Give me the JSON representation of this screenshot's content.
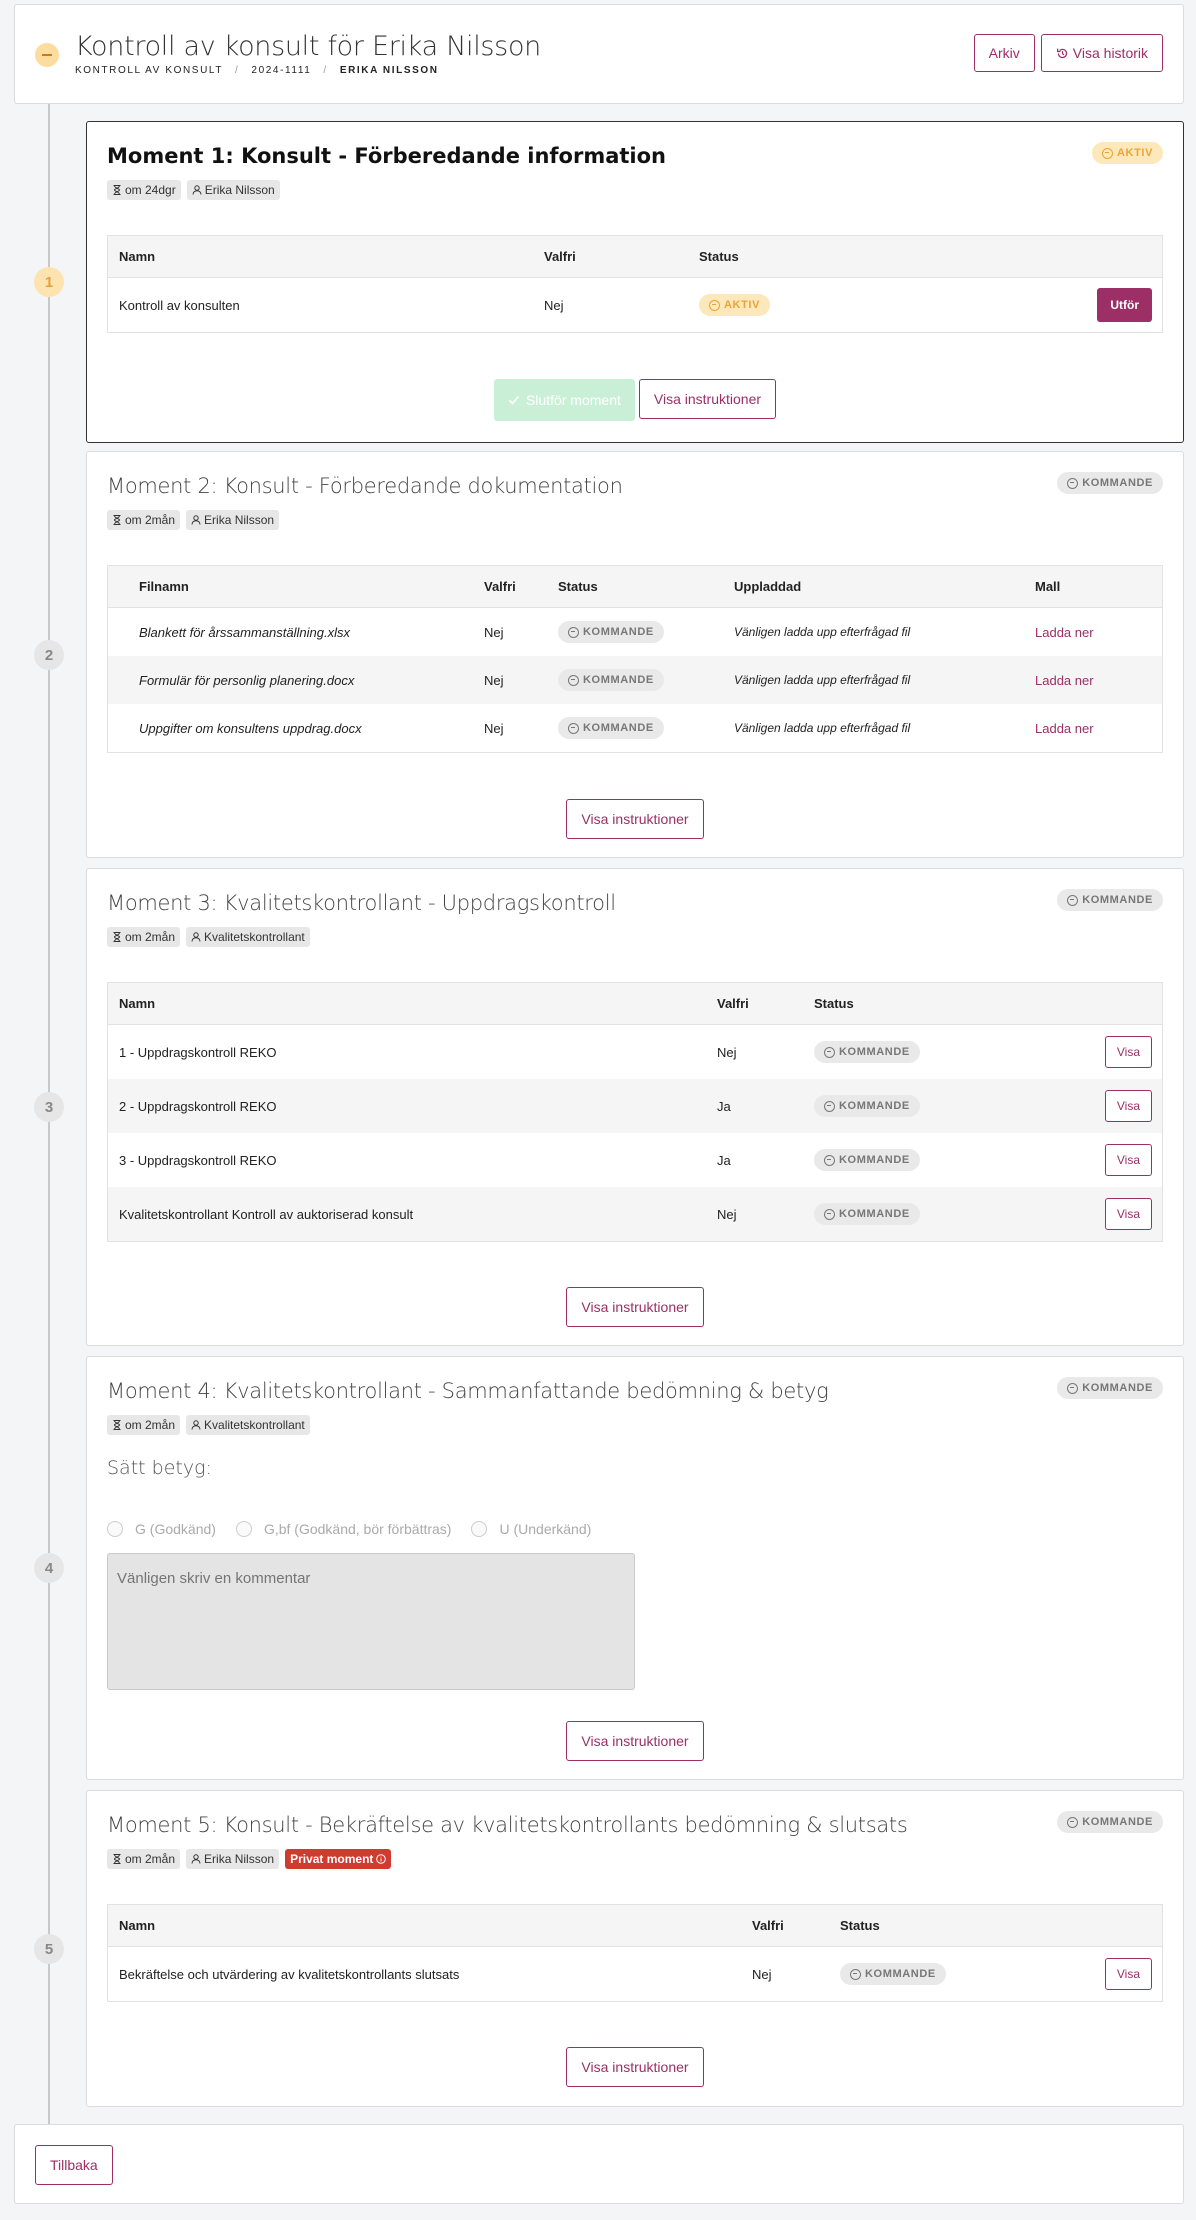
{
  "header": {
    "title": "Kontroll av konsult för Erika Nilsson",
    "crumb1": "KONTROLL AV KONSULT",
    "crumb2": "2024-1111",
    "crumb3": "ERIKA NILSSON",
    "sep": "/",
    "archive_label": "Arkiv",
    "history_label": "Visa historik"
  },
  "steps": [
    "1",
    "2",
    "3",
    "4",
    "5"
  ],
  "common": {
    "instructions_label": "Visa instruktioner",
    "status_kommande": "KOMMANDE",
    "status_aktiv": "AKTIV"
  },
  "moment1": {
    "title": "Moment 1: Konsult - Förberedande information",
    "due": "om 24dgr",
    "assignee": "Erika Nilsson",
    "status": "AKTIV",
    "columns": [
      "Namn",
      "Valfri",
      "Status"
    ],
    "rows": [
      {
        "name": "Kontroll av konsulten",
        "optional": "Nej",
        "status": "AKTIV",
        "action": "Utför"
      }
    ],
    "complete_label": "Slutför moment"
  },
  "moment2": {
    "title": "Moment 2: Konsult - Förberedande dokumentation",
    "due": "om 2mån",
    "assignee": "Erika Nilsson",
    "status": "KOMMANDE",
    "columns": [
      "Filnamn",
      "Valfri",
      "Status",
      "Uppladdad",
      "Mall"
    ],
    "rows": [
      {
        "file": "Blankett för årssammanställning.xlsx",
        "optional": "Nej",
        "status": "KOMMANDE",
        "uploaded": "Vänligen ladda upp efterfrågad fil",
        "template": "Ladda ner"
      },
      {
        "file": "Formulär för personlig planering.docx",
        "optional": "Nej",
        "status": "KOMMANDE",
        "uploaded": "Vänligen ladda upp efterfrågad fil",
        "template": "Ladda ner"
      },
      {
        "file": "Uppgifter om konsultens uppdrag.docx",
        "optional": "Nej",
        "status": "KOMMANDE",
        "uploaded": "Vänligen ladda upp efterfrågad fil",
        "template": "Ladda ner"
      }
    ]
  },
  "moment3": {
    "title": "Moment 3: Kvalitetskontrollant - Uppdragskontroll",
    "due": "om 2mån",
    "assignee": "Kvalitetskontrollant",
    "status": "KOMMANDE",
    "columns": [
      "Namn",
      "Valfri",
      "Status"
    ],
    "rows": [
      {
        "name": "1 - Uppdragskontroll REKO",
        "optional": "Nej",
        "status": "KOMMANDE",
        "action": "Visa"
      },
      {
        "name": "2 - Uppdragskontroll REKO",
        "optional": "Ja",
        "status": "KOMMANDE",
        "action": "Visa"
      },
      {
        "name": "3 - Uppdragskontroll REKO",
        "optional": "Ja",
        "status": "KOMMANDE",
        "action": "Visa"
      },
      {
        "name": "Kvalitetskontrollant Kontroll av auktoriserad konsult",
        "optional": "Nej",
        "status": "KOMMANDE",
        "action": "Visa"
      }
    ]
  },
  "moment4": {
    "title": "Moment 4: Kvalitetskontrollant - Sammanfattande bedömning & betyg",
    "due": "om 2mån",
    "assignee": "Kvalitetskontrollant",
    "status": "KOMMANDE",
    "grade_label": "Sätt betyg:",
    "options": [
      "G (Godkänd)",
      "G,bf (Godkänd, bör förbättras)",
      "U (Underkänd)"
    ],
    "comment_placeholder": "Vänligen skriv en kommentar"
  },
  "moment5": {
    "title": "Moment 5: Konsult - Bekräftelse av kvalitetskontrollants bedömning & slutsats",
    "due": "om 2mån",
    "assignee": "Erika Nilsson",
    "private_label": "Privat moment",
    "status": "KOMMANDE",
    "columns": [
      "Namn",
      "Valfri",
      "Status"
    ],
    "rows": [
      {
        "name": "Bekräftelse och utvärdering av kvalitetskontrollants slutsats",
        "optional": "Nej",
        "status": "KOMMANDE",
        "action": "Visa"
      }
    ]
  },
  "footer": {
    "back_label": "Tillbaka"
  },
  "colors": {
    "accent": "#9b2f66",
    "active": "#eaa436",
    "private": "#d03b2f"
  }
}
